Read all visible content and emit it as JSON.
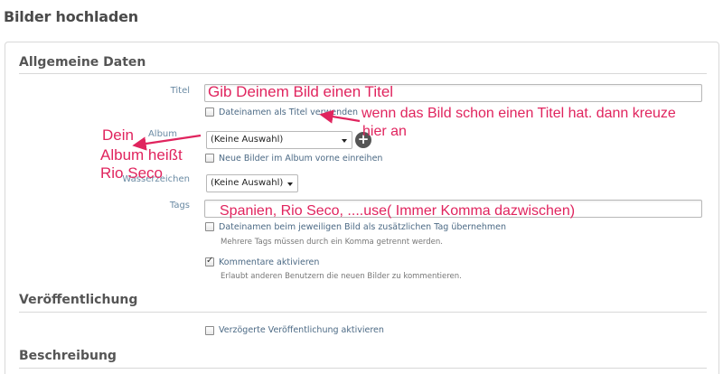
{
  "page": {
    "title": "Bilder hochladen"
  },
  "sections": {
    "general": "Allgemeine Daten",
    "publishing": "Veröffentlichung",
    "description": "Beschreibung"
  },
  "fields": {
    "title_label": "Titel",
    "title_value": "",
    "use_filename_title": "Dateinamen als Titel verwenden",
    "album_label": "Album",
    "album_value": "(Keine Auswahl)",
    "new_images_front": "Neue Bilder im Album vorne einreihen",
    "watermark_label": "Wasserzeichen",
    "watermark_value": "(Keine Auswahl)",
    "tags_label": "Tags",
    "tags_value": "",
    "filename_tag": "Dateinamen beim jeweiligen Bild als zusätzlichen Tag übernehmen",
    "tags_hint": "Mehrere Tags müssen durch ein Komma getrennt werden.",
    "comments_enable": "Kommentare aktivieren",
    "comments_hint": "Erlaubt anderen Benutzern die neuen Bilder zu kommentieren.",
    "delayed_publish": "Verzögerte Veröffentlichung aktivieren"
  },
  "checkboxes": {
    "use_filename_title": false,
    "new_images_front": false,
    "filename_tag": false,
    "comments_enable": true,
    "delayed_publish": false
  },
  "annotations": {
    "title_note": "Gib Deinem Bild einen Titel",
    "filename_note_1": "wenn das Bild schon einen Titel hat. dann kreuze",
    "filename_note_2": "hier an",
    "album_note_1": "Dein",
    "album_note_2": "Album heißt",
    "album_note_3": "Rio Seco",
    "tags_note": "Spanien, Rio Seco, ....use( Immer Komma dazwischen)"
  },
  "colors": {
    "annotation": "#e0245e",
    "label": "#6a8aa3"
  },
  "icons": {
    "add_album": "plus-circle-icon",
    "dropdown": "chevron-down-icon"
  }
}
